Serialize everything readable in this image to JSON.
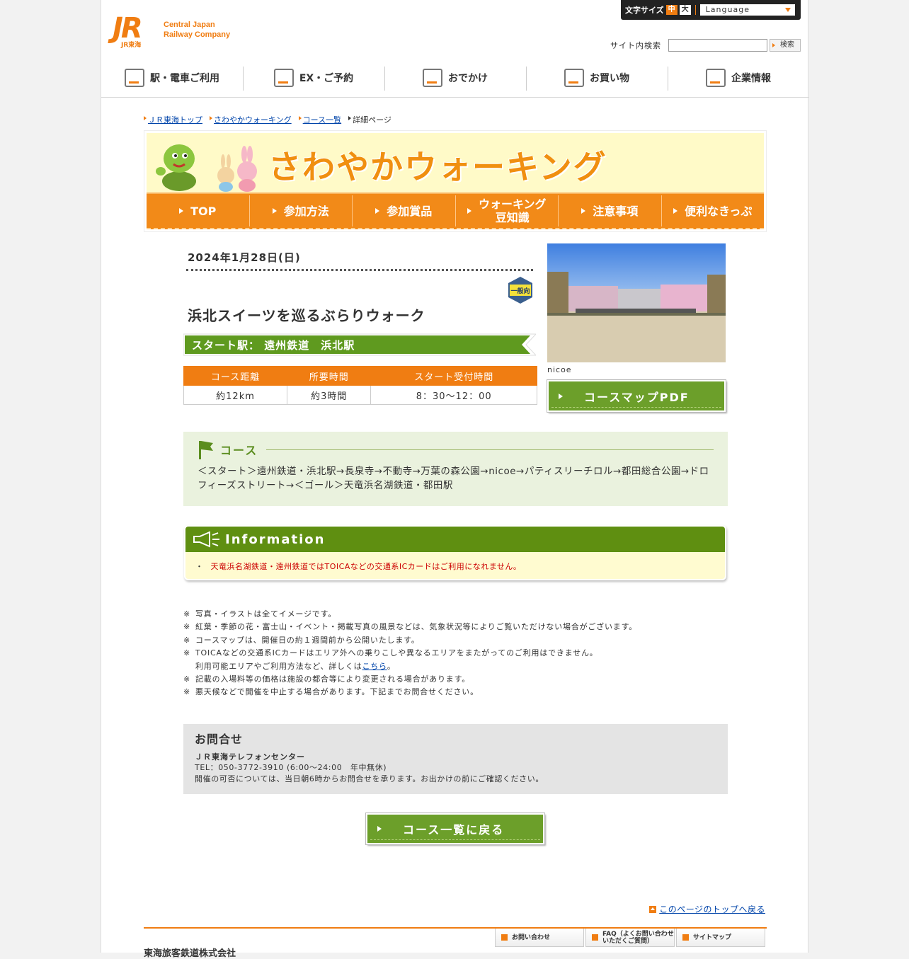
{
  "header": {
    "logo_mark": "JR",
    "logo_sub": "JR東海",
    "logo_line1": "Central Japan",
    "logo_line2": "Railway Company",
    "font_size_label": "文字サイズ",
    "font_size_mid": "中",
    "font_size_big": "大",
    "language": "Language",
    "search_label": "サイト内検索",
    "search_value": "",
    "search_button": "検索"
  },
  "gnav": [
    {
      "label": "駅・電車ご利用",
      "icon": "train-icon"
    },
    {
      "label": "EX・ご予約",
      "icon": "reservation-icon"
    },
    {
      "label": "おでかけ",
      "icon": "suitcase-icon"
    },
    {
      "label": "お買い物",
      "icon": "shopping-bag-icon"
    },
    {
      "label": "企業情報",
      "icon": "building-icon"
    }
  ],
  "breadcrumb": [
    "ＪＲ東海トップ",
    "さわやかウォーキング",
    "コース一覧",
    "詳細ページ"
  ],
  "banner": {
    "title": "さわやかウォーキング",
    "nav": [
      "TOP",
      "参加方法",
      "参加賞品",
      "ウォーキング豆知識",
      "注意事項",
      "便利なきっぷ"
    ],
    "nav_line1": "ウォーキング",
    "nav_line2": "豆知識"
  },
  "event": {
    "date": "2024年1月28日(日)",
    "badge": "一般向",
    "title": "浜北スイーツを巡るぶらりウォーク",
    "start_station": "スタート駅：  遠州鉄道　浜北駅",
    "table_headers": [
      "コース距離",
      "所要時間",
      "スタート受付時間"
    ],
    "table_values": [
      "約12km",
      "約3時間",
      "8：30～12：00"
    ],
    "photo_caption": "nicoe",
    "pdf_button": "コースマップPDF"
  },
  "course": {
    "heading": "コース",
    "text": "＜スタート＞遠州鉄道・浜北駅→長泉寺→不動寺→万葉の森公園→nicoe→パティスリーチロル→都田総合公園→ドロフィーズストリート→＜ゴール＞天竜浜名湖鉄道・都田駅"
  },
  "information": {
    "heading": "Information",
    "bullet": "・",
    "text": "天竜浜名湖鉄道・遠州鉄道ではTOICAなどの交通系ICカードはご利用になれません。"
  },
  "notes": {
    "mark": "※",
    "n1": "写真・イラストは全てイメージです。",
    "n2": "紅葉・季節の花・富士山・イベント・掲載写真の風景などは、気象状況等によりご覧いただけない場合がございます。",
    "n3": "コースマップは、開催日の約１週間前から公開いたします。",
    "n4": "TOICAなどの交通系ICカードはエリア外への乗りこしや異なるエリアをまたがってのご利用はできません。",
    "n4b_pre": "利用可能エリアやご利用方法など、詳しくは",
    "n4b_link": "こちら",
    "n4b_post": "。",
    "n5": "記載の入場料等の価格は施設の都合等により変更される場合があります。",
    "n6": "悪天候などで開催を中止する場合があります。下記までお問合せください。"
  },
  "contact": {
    "heading": "お問合せ",
    "name": "ＪＲ東海テレフォンセンター",
    "tel": "TEL：050-3772-3910 (6:00～24:00　年中無休)",
    "note": "開催の可否については、当日朝6時からお問合せを承ります。お出かけの前にご確認ください。"
  },
  "back_button": "コース一覧に戻る",
  "to_top": "このページのトップへ戻る",
  "footer": {
    "links": [
      "お問い合わせ",
      "FAQ（よくお問い合わせいただくご質問）",
      "サイトマップ"
    ],
    "company": "東海旅客鉄道株式会社"
  },
  "colors": {
    "accent": "#f07d12",
    "green": "#6c9f2a",
    "info_green": "#5f8f11"
  }
}
